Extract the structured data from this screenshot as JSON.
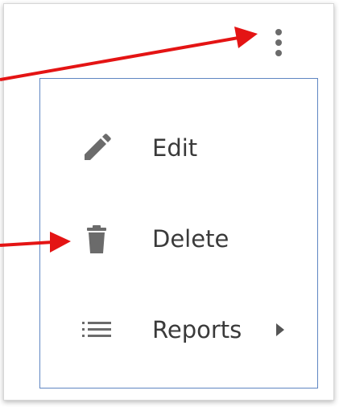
{
  "menu": {
    "items": [
      {
        "label": "Edit",
        "icon": "pencil-icon"
      },
      {
        "label": "Delete",
        "icon": "trash-icon"
      },
      {
        "label": "Reports",
        "icon": "list-icon",
        "submenu_icon": "caret-right-icon"
      }
    ]
  },
  "kebab_icon": "more-vert-icon",
  "colors": {
    "icon": "#6b6b6b",
    "text": "#3a3a3a",
    "menu_border": "#5f86c2",
    "annotation_arrow": "#e41414"
  }
}
